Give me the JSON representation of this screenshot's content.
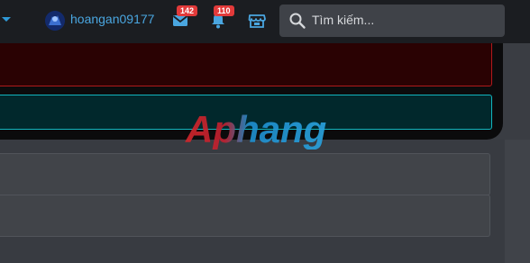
{
  "header": {
    "username": "hoangan09177",
    "inbox_badge": "142",
    "alerts_badge": "110",
    "icons": [
      "caret-down-icon",
      "avatar",
      "mail-icon",
      "bell-icon",
      "store-icon"
    ]
  },
  "search": {
    "placeholder": "Tìm kiếm..."
  },
  "watermark": {
    "text": "Aphang"
  },
  "colors": {
    "topbar": "#1b1d21",
    "accent": "#4aa6e0",
    "badge": "#e23a3a",
    "alert_red_border": "#b0191b",
    "alert_cyan_border": "#12b5be",
    "watermark_red": "#d3262b",
    "watermark_blue": "#1e8fd0"
  }
}
